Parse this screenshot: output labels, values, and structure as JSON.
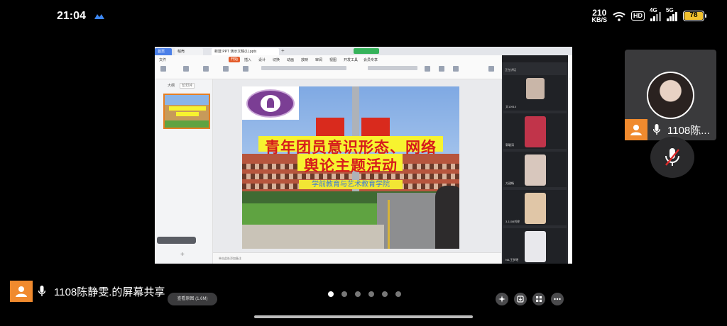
{
  "status_bar": {
    "time": "21:04",
    "net_speed_value": "210",
    "net_speed_unit": "KB/S",
    "hd_label": "HD",
    "signal1_gen": "4G",
    "signal2_gen": "5G",
    "battery": "78"
  },
  "wps": {
    "tabs": [
      "首页",
      "稻壳",
      "新建 PPT 演示文稿(1).pptx"
    ],
    "menu": [
      "文件",
      "开始",
      "插入",
      "设计",
      "切换",
      "动画",
      "放映",
      "审阅",
      "视图",
      "开发工具",
      "会员专享"
    ],
    "active_menu": "开始",
    "left_tabs": [
      "大纲",
      "幻灯片"
    ],
    "notes_placeholder": "单击此处添加备注",
    "meeting_panel_title": "正在讲话",
    "participants": [
      "文10910",
      "郭聪涛",
      "方甜畅",
      "3-1108刘梓",
      "NIL王梦瑶"
    ]
  },
  "slide": {
    "title_line1": "青年团员意识形态、网络",
    "title_line2": "舆论主题活动",
    "subtitle": "学前教育与艺术教育学院"
  },
  "self_tile": {
    "name": "1108陈..."
  },
  "bottom": {
    "share_text": "1108陈静雯.的屏幕共享",
    "view_original": "查看原图 (1.6M)",
    "page_count": 6,
    "active_page": 1
  },
  "colors": {
    "accent_orange": "#f08a2e",
    "title_red": "#d61c1c",
    "highlight_yellow": "#f7f32f",
    "wps_accent": "#e45c2b"
  }
}
